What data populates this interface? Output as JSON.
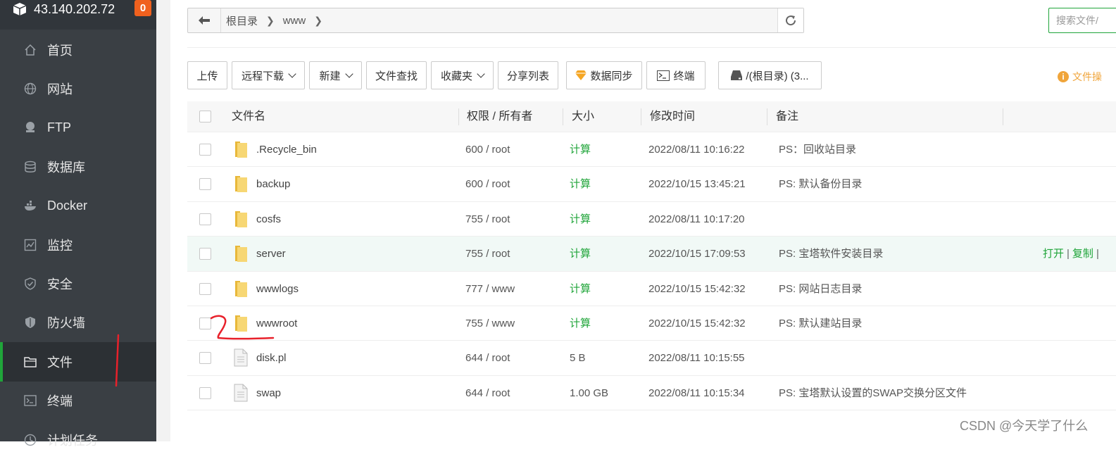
{
  "server": {
    "ip": "43.140.202.72",
    "badge": "0"
  },
  "sidebar": {
    "items": [
      {
        "label": "首页",
        "icon": "home-icon"
      },
      {
        "label": "网站",
        "icon": "globe-icon"
      },
      {
        "label": "FTP",
        "icon": "ftp-icon"
      },
      {
        "label": "数据库",
        "icon": "database-icon"
      },
      {
        "label": "Docker",
        "icon": "docker-icon"
      },
      {
        "label": "监控",
        "icon": "monitor-icon"
      },
      {
        "label": "安全",
        "icon": "shield-check-icon"
      },
      {
        "label": "防火墙",
        "icon": "firewall-icon"
      },
      {
        "label": "文件",
        "icon": "folder-icon",
        "active": true
      },
      {
        "label": "终端",
        "icon": "terminal-icon"
      },
      {
        "label": "计划任务",
        "icon": "task-icon"
      }
    ]
  },
  "path": {
    "crumbs": [
      "根目录",
      "www"
    ]
  },
  "search": {
    "placeholder": "搜索文件/"
  },
  "toolbar": {
    "upload": "上传",
    "remote_download": "远程下载",
    "new": "新建",
    "find": "文件查找",
    "favorites": "收藏夹",
    "share_list": "分享列表",
    "sync": "数据同步",
    "terminal": "终端",
    "disk": "/(根目录) (3..."
  },
  "help_link": "文件操",
  "table": {
    "headers": {
      "name": "文件名",
      "perm": "权限 / 所有者",
      "size": "大小",
      "mtime": "修改时间",
      "note": "备注"
    },
    "rows": [
      {
        "type": "folder",
        "name": ".Recycle_bin",
        "perm": "600 / root",
        "size": "计算",
        "mtime": "2022/08/11 10:16:22",
        "note": "PS：回收站目录"
      },
      {
        "type": "folder",
        "name": "backup",
        "perm": "600 / root",
        "size": "计算",
        "mtime": "2022/10/15 13:45:21",
        "note": "PS: 默认备份目录"
      },
      {
        "type": "folder",
        "name": "cosfs",
        "perm": "755 / root",
        "size": "计算",
        "mtime": "2022/08/11 10:17:20",
        "note": ""
      },
      {
        "type": "folder",
        "name": "server",
        "perm": "755 / root",
        "size": "计算",
        "mtime": "2022/10/15 17:09:53",
        "note": "PS: 宝塔软件安装目录",
        "highlight": true,
        "ops": [
          "打开",
          "复制"
        ]
      },
      {
        "type": "folder",
        "name": "wwwlogs",
        "perm": "777 / www",
        "size": "计算",
        "mtime": "2022/10/15 15:42:32",
        "note": "PS: 网站日志目录"
      },
      {
        "type": "folder",
        "name": "wwwroot",
        "perm": "755 / www",
        "size": "计算",
        "mtime": "2022/10/15 15:42:32",
        "note": "PS: 默认建站目录"
      },
      {
        "type": "file",
        "name": "disk.pl",
        "perm": "644 / root",
        "size": "5 B",
        "mtime": "2022/08/11 10:15:55",
        "note": ""
      },
      {
        "type": "file",
        "name": "swap",
        "perm": "644 / root",
        "size": "1.00 GB",
        "mtime": "2022/08/11 10:15:34",
        "note": "PS: 宝塔默认设置的SWAP交换分区文件"
      }
    ]
  },
  "watermark": "CSDN @今天学了什么",
  "colors": {
    "accent": "#20a53a",
    "sidebar": "#3a3f44",
    "badge": "#f0611e",
    "annotation": "#e8212b"
  }
}
